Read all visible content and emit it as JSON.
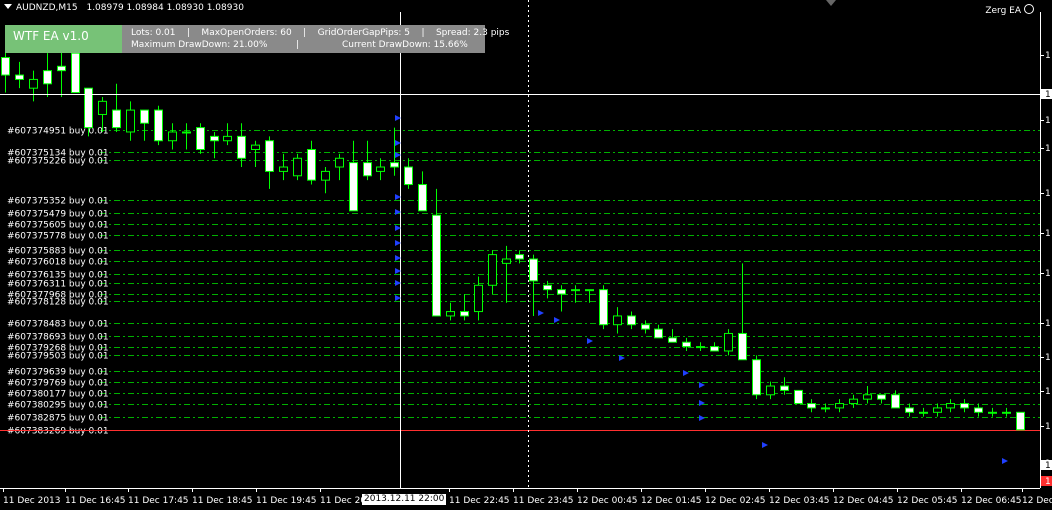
{
  "header": {
    "symbol": "AUDNZD,M15",
    "ohlc": "1.08979 1.08984 1.08930 1.08930",
    "indicator_label": "Zerg EA"
  },
  "panel": {
    "title": "WTF EA v1.0",
    "row1": "Lots: 0.01    |    MaxOpenOrders: 60    |    GridOrderGapPips: 5    |    Spread: 2.3 pips",
    "row2": "Maximum DrawDown: 21.00%          |               Current DrawDown: 15.66%"
  },
  "cursor_label": "2013.12.11 22:00",
  "colors": {
    "bull": "#000000",
    "bear": "#ffffff",
    "wick": "#00ff00",
    "order_line": "#00b000",
    "price_line": "#ff3030",
    "arrow": "#2040ff"
  },
  "chart_data": {
    "type": "candlestick",
    "x_tick_labels": [
      "11 Dec 2013",
      "11 Dec 16:45",
      "11 Dec 17:45",
      "11 Dec 18:45",
      "11 Dec 19:45",
      "11 Dec 20",
      "11 Dec 22:45",
      "11 Dec 23:45",
      "12 Dec 00:45",
      "12 Dec 01:45",
      "12 Dec 02:45",
      "12 Dec 03:45",
      "12 Dec 04:45",
      "12 Dec 05:45",
      "12 Dec 06:45",
      "12 Dec"
    ],
    "y_axis_marks": [
      "1",
      "1",
      "1",
      "1",
      "1",
      "1",
      "1",
      "1",
      "1",
      "1",
      "1",
      "1",
      "1",
      "1",
      "1"
    ],
    "candles": [
      {
        "o": 0.96,
        "h": 1.0,
        "l": 0.88,
        "c": 0.92
      },
      {
        "o": 0.92,
        "h": 0.95,
        "l": 0.89,
        "c": 0.91
      },
      {
        "o": 0.89,
        "h": 0.93,
        "l": 0.86,
        "c": 0.91
      },
      {
        "o": 0.93,
        "h": 0.97,
        "l": 0.87,
        "c": 0.9
      },
      {
        "o": 0.94,
        "h": 0.99,
        "l": 0.87,
        "c": 0.93
      },
      {
        "o": 0.97,
        "h": 1.0,
        "l": 0.88,
        "c": 0.88
      },
      {
        "o": 0.89,
        "h": 0.89,
        "l": 0.78,
        "c": 0.8
      },
      {
        "o": 0.83,
        "h": 0.87,
        "l": 0.79,
        "c": 0.86
      },
      {
        "o": 0.84,
        "h": 0.9,
        "l": 0.79,
        "c": 0.8
      },
      {
        "o": 0.79,
        "h": 0.86,
        "l": 0.77,
        "c": 0.84
      },
      {
        "o": 0.84,
        "h": 0.84,
        "l": 0.77,
        "c": 0.81
      },
      {
        "o": 0.84,
        "h": 0.85,
        "l": 0.76,
        "c": 0.77
      },
      {
        "o": 0.77,
        "h": 0.81,
        "l": 0.75,
        "c": 0.79
      },
      {
        "o": 0.79,
        "h": 0.81,
        "l": 0.75,
        "c": 0.79
      },
      {
        "o": 0.8,
        "h": 0.81,
        "l": 0.74,
        "c": 0.75
      },
      {
        "o": 0.78,
        "h": 0.79,
        "l": 0.73,
        "c": 0.77
      },
      {
        "o": 0.77,
        "h": 0.81,
        "l": 0.76,
        "c": 0.78
      },
      {
        "o": 0.78,
        "h": 0.81,
        "l": 0.71,
        "c": 0.73
      },
      {
        "o": 0.75,
        "h": 0.77,
        "l": 0.71,
        "c": 0.76
      },
      {
        "o": 0.77,
        "h": 0.78,
        "l": 0.66,
        "c": 0.7
      },
      {
        "o": 0.7,
        "h": 0.74,
        "l": 0.68,
        "c": 0.71
      },
      {
        "o": 0.69,
        "h": 0.74,
        "l": 0.68,
        "c": 0.73
      },
      {
        "o": 0.75,
        "h": 0.77,
        "l": 0.67,
        "c": 0.68
      },
      {
        "o": 0.68,
        "h": 0.71,
        "l": 0.65,
        "c": 0.7
      },
      {
        "o": 0.71,
        "h": 0.74,
        "l": 0.68,
        "c": 0.73
      },
      {
        "o": 0.72,
        "h": 0.77,
        "l": 0.66,
        "c": 0.61
      },
      {
        "o": 0.72,
        "h": 0.77,
        "l": 0.68,
        "c": 0.69
      },
      {
        "o": 0.7,
        "h": 0.73,
        "l": 0.68,
        "c": 0.71
      },
      {
        "o": 0.72,
        "h": 0.8,
        "l": 0.69,
        "c": 0.71
      },
      {
        "o": 0.71,
        "h": 0.73,
        "l": 0.66,
        "c": 0.67
      },
      {
        "o": 0.67,
        "h": 0.7,
        "l": 0.66,
        "c": 0.61
      },
      {
        "o": 0.6,
        "h": 0.66,
        "l": 0.56,
        "c": 0.37
      },
      {
        "o": 0.37,
        "h": 0.4,
        "l": 0.36,
        "c": 0.38
      },
      {
        "o": 0.38,
        "h": 0.42,
        "l": 0.36,
        "c": 0.37
      },
      {
        "o": 0.38,
        "h": 0.46,
        "l": 0.36,
        "c": 0.44
      },
      {
        "o": 0.44,
        "h": 0.52,
        "l": 0.42,
        "c": 0.51
      },
      {
        "o": 0.49,
        "h": 0.53,
        "l": 0.4,
        "c": 0.5
      },
      {
        "o": 0.51,
        "h": 0.52,
        "l": 0.49,
        "c": 0.5
      },
      {
        "o": 0.5,
        "h": 0.51,
        "l": 0.37,
        "c": 0.45
      },
      {
        "o": 0.44,
        "h": 0.45,
        "l": 0.41,
        "c": 0.43
      },
      {
        "o": 0.43,
        "h": 0.44,
        "l": 0.38,
        "c": 0.42
      },
      {
        "o": 0.43,
        "h": 0.44,
        "l": 0.4,
        "c": 0.43
      },
      {
        "o": 0.43,
        "h": 0.43,
        "l": 0.4,
        "c": 0.43
      },
      {
        "o": 0.43,
        "h": 0.44,
        "l": 0.34,
        "c": 0.35
      },
      {
        "o": 0.35,
        "h": 0.39,
        "l": 0.33,
        "c": 0.37
      },
      {
        "o": 0.37,
        "h": 0.38,
        "l": 0.34,
        "c": 0.35
      },
      {
        "o": 0.35,
        "h": 0.36,
        "l": 0.33,
        "c": 0.34
      },
      {
        "o": 0.34,
        "h": 0.35,
        "l": 0.32,
        "c": 0.32
      },
      {
        "o": 0.32,
        "h": 0.34,
        "l": 0.31,
        "c": 0.31
      },
      {
        "o": 0.31,
        "h": 0.32,
        "l": 0.29,
        "c": 0.3
      },
      {
        "o": 0.3,
        "h": 0.31,
        "l": 0.29,
        "c": 0.3
      },
      {
        "o": 0.3,
        "h": 0.31,
        "l": 0.29,
        "c": 0.29
      },
      {
        "o": 0.29,
        "h": 0.34,
        "l": 0.28,
        "c": 0.33
      },
      {
        "o": 0.33,
        "h": 0.49,
        "l": 0.29,
        "c": 0.27
      },
      {
        "o": 0.27,
        "h": 0.28,
        "l": 0.18,
        "c": 0.19
      },
      {
        "o": 0.19,
        "h": 0.22,
        "l": 0.18,
        "c": 0.21
      },
      {
        "o": 0.21,
        "h": 0.23,
        "l": 0.19,
        "c": 0.2
      },
      {
        "o": 0.2,
        "h": 0.2,
        "l": 0.17,
        "c": 0.17
      },
      {
        "o": 0.17,
        "h": 0.18,
        "l": 0.15,
        "c": 0.16
      },
      {
        "o": 0.16,
        "h": 0.17,
        "l": 0.15,
        "c": 0.16
      },
      {
        "o": 0.16,
        "h": 0.18,
        "l": 0.15,
        "c": 0.17
      },
      {
        "o": 0.17,
        "h": 0.19,
        "l": 0.16,
        "c": 0.18
      },
      {
        "o": 0.18,
        "h": 0.21,
        "l": 0.17,
        "c": 0.19
      },
      {
        "o": 0.19,
        "h": 0.19,
        "l": 0.17,
        "c": 0.18
      },
      {
        "o": 0.19,
        "h": 0.2,
        "l": 0.16,
        "c": 0.16
      },
      {
        "o": 0.16,
        "h": 0.17,
        "l": 0.14,
        "c": 0.15
      },
      {
        "o": 0.15,
        "h": 0.16,
        "l": 0.14,
        "c": 0.15
      },
      {
        "o": 0.15,
        "h": 0.17,
        "l": 0.14,
        "c": 0.16
      },
      {
        "o": 0.16,
        "h": 0.18,
        "l": 0.15,
        "c": 0.17
      },
      {
        "o": 0.17,
        "h": 0.18,
        "l": 0.15,
        "c": 0.16
      },
      {
        "o": 0.16,
        "h": 0.17,
        "l": 0.14,
        "c": 0.15
      },
      {
        "o": 0.15,
        "h": 0.16,
        "l": 0.14,
        "c": 0.15
      },
      {
        "o": 0.15,
        "h": 0.16,
        "l": 0.14,
        "c": 0.15
      },
      {
        "o": 0.15,
        "h": 0.15,
        "l": 0.11,
        "c": 0.11
      }
    ],
    "orders": [
      {
        "label": "#607374951 buy 0.01",
        "price": 0.795
      },
      {
        "label": "#607375134 buy 0.01",
        "price": 0.745
      },
      {
        "label": "#607375226 buy 0.01",
        "price": 0.725
      },
      {
        "label": "#607375352 buy 0.01",
        "price": 0.635
      },
      {
        "label": "#607375479 buy 0.01",
        "price": 0.605
      },
      {
        "label": "#607375605 buy 0.01",
        "price": 0.58
      },
      {
        "label": "#607375778 buy 0.01",
        "price": 0.555
      },
      {
        "label": "#607375883 buy 0.01",
        "price": 0.52
      },
      {
        "label": "#607376018 buy 0.01",
        "price": 0.495
      },
      {
        "label": "#607376135 buy 0.01",
        "price": 0.465
      },
      {
        "label": "#607376311 buy 0.01",
        "price": 0.445
      },
      {
        "label": "#607377968 buy 0.01",
        "price": 0.42
      },
      {
        "label": "#607378128 buy 0.01",
        "price": 0.405
      },
      {
        "label": "#607378483 buy 0.01",
        "price": 0.355
      },
      {
        "label": "#607378693 buy 0.01",
        "price": 0.325
      },
      {
        "label": "#607379268 buy 0.01",
        "price": 0.3
      },
      {
        "label": "#607379503 buy 0.01",
        "price": 0.28
      },
      {
        "label": "#607379639 buy 0.01",
        "price": 0.245
      },
      {
        "label": "#607379769 buy 0.01",
        "price": 0.22
      },
      {
        "label": "#607380177 buy 0.01",
        "price": 0.195
      },
      {
        "label": "#607380295 buy 0.01",
        "price": 0.17
      },
      {
        "label": "#607382875 buy 0.01",
        "price": 0.14
      },
      {
        "label": "#607383269 buy 0.01",
        "price": 0.11
      }
    ],
    "current_price": 0.11,
    "ylim": [
      0.0,
      1.0
    ],
    "grid": false
  }
}
